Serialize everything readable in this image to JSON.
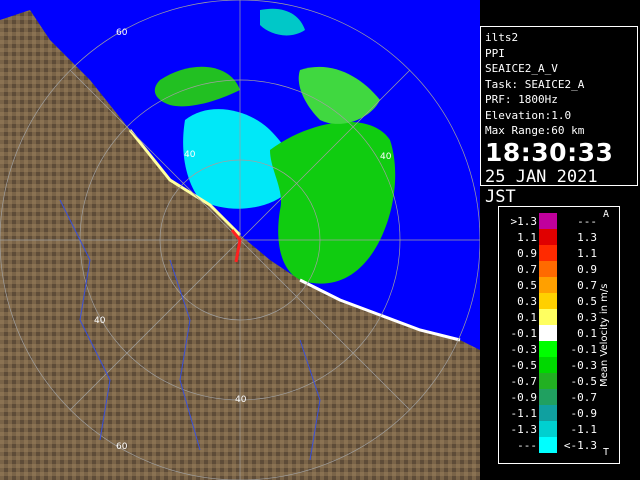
{
  "info": {
    "site": "ilts2",
    "scan_type": "PPI",
    "product": "SEAICE2_A_V",
    "task": "Task: SEAICE2_A",
    "prf": "PRF: 1800Hz",
    "elevation": "Elevation:1.0",
    "max_range": "Max Range:60 km",
    "time": "18:30:33",
    "date": "25 JAN 2021 JST"
  },
  "legend": {
    "title": "Mean Velocity in m/s",
    "corner_top": "A",
    "corner_bottom": "T",
    "rows": [
      {
        "left": ">1.3",
        "right": "---",
        "color": "#c0009c"
      },
      {
        "left": "1.1",
        "right": "1.3",
        "color": "#e00000"
      },
      {
        "left": "0.9",
        "right": "1.1",
        "color": "#ff2a00"
      },
      {
        "left": "0.7",
        "right": "0.9",
        "color": "#ff6a00"
      },
      {
        "left": "0.5",
        "right": "0.7",
        "color": "#ffa000"
      },
      {
        "left": "0.3",
        "right": "0.5",
        "color": "#ffd000"
      },
      {
        "left": "0.1",
        "right": "0.3",
        "color": "#ffff60"
      },
      {
        "left": "-0.1",
        "right": "0.1",
        "color": "#ffffff"
      },
      {
        "left": "-0.3",
        "right": "-0.1",
        "color": "#00ff00"
      },
      {
        "left": "-0.5",
        "right": "-0.3",
        "color": "#00d800"
      },
      {
        "left": "-0.7",
        "right": "-0.5",
        "color": "#22b022"
      },
      {
        "left": "-0.9",
        "right": "-0.7",
        "color": "#20a060"
      },
      {
        "left": "-1.1",
        "right": "-0.9",
        "color": "#10a0a0"
      },
      {
        "left": "-1.3",
        "right": "-1.1",
        "color": "#00d0d0"
      },
      {
        "left": "---",
        "right": "<-1.3",
        "color": "#00ffff"
      }
    ]
  },
  "range_labels": [
    "60",
    "40",
    "40",
    "40",
    "40",
    "60"
  ]
}
